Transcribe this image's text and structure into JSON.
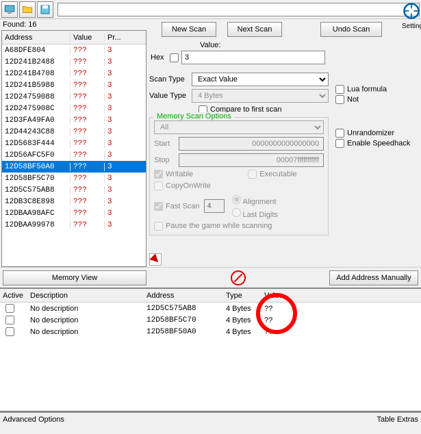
{
  "setting_label": "Setting",
  "found_label": "Found: 16",
  "columns": {
    "addr": "Address",
    "value": "Value",
    "prev": "Pr..."
  },
  "results": [
    {
      "addr": "A68DFE804",
      "value": "???",
      "prev": "3",
      "sel": false
    },
    {
      "addr": "12D241B2488",
      "value": "???",
      "prev": "3",
      "sel": false
    },
    {
      "addr": "12D241B4708",
      "value": "???",
      "prev": "3",
      "sel": false
    },
    {
      "addr": "12D241B5988",
      "value": "???",
      "prev": "3",
      "sel": false
    },
    {
      "addr": "12D24759088",
      "value": "???",
      "prev": "3",
      "sel": false
    },
    {
      "addr": "12D2475908C",
      "value": "???",
      "prev": "3",
      "sel": false
    },
    {
      "addr": "12D3FA49FA0",
      "value": "???",
      "prev": "3",
      "sel": false
    },
    {
      "addr": "12D44243C88",
      "value": "???",
      "prev": "3",
      "sel": false
    },
    {
      "addr": "12D5683F444",
      "value": "???",
      "prev": "3",
      "sel": false
    },
    {
      "addr": "12D56AFC5F0",
      "value": "???",
      "prev": "3",
      "sel": false
    },
    {
      "addr": "12D58BF50A0",
      "value": "???",
      "prev": "3",
      "sel": true
    },
    {
      "addr": "12D58BF5C70",
      "value": "???",
      "prev": "3",
      "sel": false
    },
    {
      "addr": "12D5C575AB8",
      "value": "???",
      "prev": "3",
      "sel": false
    },
    {
      "addr": "12DB3C8E898",
      "value": "???",
      "prev": "3",
      "sel": false
    },
    {
      "addr": "12DBAA98AFC",
      "value": "???",
      "prev": "3",
      "sel": false
    },
    {
      "addr": "12DBAA99978",
      "value": "???",
      "prev": "3",
      "sel": false
    }
  ],
  "buttons": {
    "new_scan": "New Scan",
    "next_scan": "Next Scan",
    "undo_scan": "Undo Scan",
    "memory_view": "Memory View",
    "add_manually": "Add Address Manually"
  },
  "labels": {
    "value": "Value:",
    "hex": "Hex",
    "scan_type": "Scan Type",
    "value_type": "Value Type",
    "compare_first": "Compare to first scan",
    "lua": "Lua formula",
    "not": "Not",
    "unrandomizer": "Unrandomizer",
    "speedhack": "Enable Speedhack",
    "mso_title": "Memory Scan Options",
    "mso_all": "All",
    "start": "Start",
    "stop": "Stop",
    "writable": "Writable",
    "executable": "Executable",
    "copyonwrite": "CopyOnWrite",
    "fast_scan": "Fast Scan",
    "alignment": "Alignment",
    "last_digits": "Last Digits",
    "pause": "Pause the game while scanning",
    "advanced": "Advanced Options",
    "table_extras": "Table Extras"
  },
  "scan": {
    "value_input": "3",
    "scan_type": "Exact Value",
    "value_type": "4 Bytes",
    "start": "0000000000000000",
    "stop": "00007fffffffffff",
    "fast_scan_n": "4"
  },
  "addr_cols": {
    "active": "Active",
    "desc": "Description",
    "addr": "Address",
    "type": "Type",
    "value": "Value"
  },
  "addr_rows": [
    {
      "desc": "No description",
      "addr": "12D5C575AB8",
      "type": "4 Bytes",
      "value": "??"
    },
    {
      "desc": "No description",
      "addr": "12D58BF5C70",
      "type": "4 Bytes",
      "value": "??"
    },
    {
      "desc": "No description",
      "addr": "12D58BF50A0",
      "type": "4 Bytes",
      "value": "??"
    }
  ]
}
